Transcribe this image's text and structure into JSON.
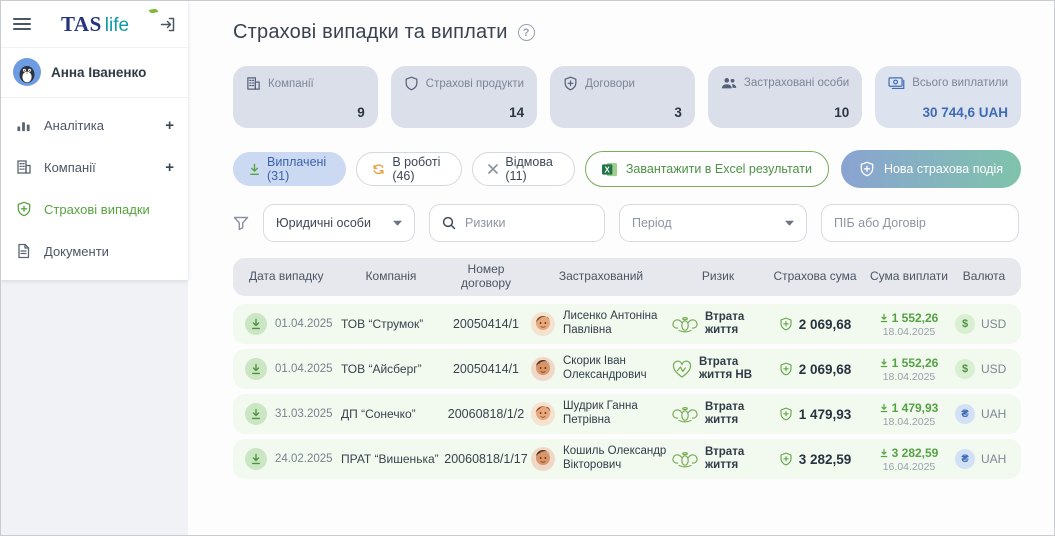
{
  "colors": {
    "accent_green": "#56a23f",
    "accent_blue": "#3e6bb5",
    "chip_selected_bg": "#ccd9f2",
    "card_bg": "#dbdfe9",
    "row_bg": "#f2f9ee",
    "gradient_from": "#8aa3d2",
    "gradient_to": "#7fc3ab"
  },
  "sidebar": {
    "logo": {
      "tas": "TAS",
      "life": "life"
    },
    "user": {
      "name": "Анна Іваненко"
    },
    "items": [
      {
        "label": "Аналітика",
        "expand": "+"
      },
      {
        "label": "Компанії",
        "expand": "+"
      },
      {
        "label": "Страхові випадки",
        "expand": ""
      },
      {
        "label": "Документи",
        "expand": ""
      }
    ]
  },
  "header": {
    "title": "Страхові випадки та виплати"
  },
  "stats": [
    {
      "label": "Компанії",
      "value": "9"
    },
    {
      "label": "Страхові продукти",
      "value": "14"
    },
    {
      "label": "Договори",
      "value": "3"
    },
    {
      "label": "Застраховані особи",
      "value": "10"
    },
    {
      "label": "Всього виплатили",
      "value": "30 744,6 UAH"
    }
  ],
  "status_filters": [
    {
      "label": "Виплачені (31)"
    },
    {
      "label": "В роботі (46)"
    },
    {
      "label": "Відмова (11)"
    }
  ],
  "actions": {
    "excel_label": "Завантажити в Excel результати",
    "new_event_label": "Нова страхова подія"
  },
  "filters": {
    "entity_value": "Юридичні особи",
    "risk_placeholder": "Ризики",
    "period_placeholder": "Період",
    "name_placeholder": "ПІБ або Договір"
  },
  "table": {
    "columns": [
      "Дата випадку",
      "Компанія",
      "Номер договору",
      "Застрахований",
      "Ризик",
      "Страхова сума",
      "Сума виплати",
      "Валюта"
    ],
    "rows": [
      {
        "date": "01.04.2025",
        "company": "ТОВ “Струмок”",
        "contract": "20050414/1",
        "insured": "Лисенко Антоніна Павлівна",
        "risk": "Втрата життя",
        "insured_sum": "2 069,68",
        "payout": "1 552,26",
        "payout_date": "18.04.2025",
        "currency": "USD"
      },
      {
        "date": "01.04.2025",
        "company": "ТОВ “Айсберг”",
        "contract": "20050414/1",
        "insured": "Скорик Іван Олександрович",
        "risk": "Втрата життя НВ",
        "insured_sum": "2 069,68",
        "payout": "1 552,26",
        "payout_date": "18.04.2025",
        "currency": "USD"
      },
      {
        "date": "31.03.2025",
        "company": "ДП “Сонечко”",
        "contract": "20060818/1/2",
        "insured": "Шудрик Ганна Петрівна",
        "risk": "Втрата життя",
        "insured_sum": "1 479,93",
        "payout": "1 479,93",
        "payout_date": "18.04.2025",
        "currency": "UAH"
      },
      {
        "date": "24.02.2025",
        "company": "ПРАТ “Вишенька”",
        "contract": "20060818/1/17",
        "insured": "Кошиль Олександр Вікторович",
        "risk": "Втрата життя",
        "insured_sum": "3 282,59",
        "payout": "3 282,59",
        "payout_date": "16.04.2025",
        "currency": "UAH"
      }
    ]
  }
}
